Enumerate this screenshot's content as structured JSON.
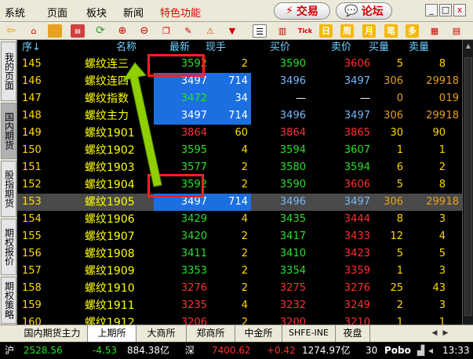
{
  "menu": {
    "items": [
      "系统",
      "页面",
      "板块",
      "新闻"
    ],
    "special": "特色功能",
    "trade": "交易",
    "forum": "论坛"
  },
  "window_buttons": {
    "minimize": "_",
    "restore": "□",
    "close": "x"
  },
  "toolbar": {
    "tick_label": "Tick",
    "chars": [
      "日",
      "周",
      "月",
      "笔",
      "多"
    ]
  },
  "left_tabs": [
    "我的页面",
    "国内期货",
    "股指期货",
    "期权报价",
    "期权策略"
  ],
  "headers": {
    "seq": "序↓",
    "name": "名称",
    "latest": "最新",
    "vol": "现手",
    "bid": "买价",
    "ask": "卖价",
    "bidv": "买量",
    "askv": "卖量"
  },
  "rows": [
    {
      "seq": "145",
      "name": "螺纹连三",
      "latest": "3592",
      "vol": "2",
      "bid": "3590",
      "ask": "3606",
      "bidv": "5",
      "askv": "8",
      "extra": "",
      "lc": "grn",
      "bc": "grn",
      "ac": "red"
    },
    {
      "seq": "146",
      "name": "螺纹连四",
      "latest": "3497",
      "vol": "714",
      "bid": "3496",
      "ask": "3497",
      "bidv": "306",
      "askv": "299",
      "extra": "18",
      "lc": "wht",
      "bc": "lb",
      "ac": "lb",
      "hl": true
    },
    {
      "seq": "147",
      "name": "螺纹指数",
      "latest": "3472",
      "vol": "34",
      "bid": "—",
      "ask": "—",
      "bidv": "0",
      "askv": "0",
      "extra": "19",
      "lc": "grn",
      "bc": "wht",
      "ac": "wht",
      "hl": true
    },
    {
      "seq": "148",
      "name": "螺纹主力",
      "latest": "3497",
      "vol": "714",
      "bid": "3496",
      "ask": "3497",
      "bidv": "306",
      "askv": "299",
      "extra": "18",
      "lc": "wht",
      "bc": "lb",
      "ac": "lb",
      "hl": true
    },
    {
      "seq": "149",
      "name": "螺纹1901",
      "latest": "3864",
      "vol": "60",
      "bid": "3864",
      "ask": "3865",
      "bidv": "30",
      "askv": "90",
      "extra": "",
      "lc": "red",
      "bc": "red",
      "ac": "red"
    },
    {
      "seq": "150",
      "name": "螺纹1902",
      "latest": "3595",
      "vol": "4",
      "bid": "3594",
      "ask": "3607",
      "bidv": "1",
      "askv": "1",
      "extra": "",
      "lc": "grn",
      "bc": "grn",
      "ac": "grn"
    },
    {
      "seq": "151",
      "name": "螺纹1903",
      "latest": "3577",
      "vol": "2",
      "bid": "3580",
      "ask": "3594",
      "bidv": "6",
      "askv": "2",
      "extra": "",
      "lc": "grn",
      "bc": "grn",
      "ac": "grn"
    },
    {
      "seq": "152",
      "name": "螺纹1904",
      "latest": "3592",
      "vol": "2",
      "bid": "3590",
      "ask": "3606",
      "bidv": "5",
      "askv": "8",
      "extra": "",
      "lc": "grn",
      "bc": "grn",
      "ac": "red"
    },
    {
      "seq": "153",
      "name": "螺纹1905",
      "latest": "3497",
      "vol": "714",
      "bid": "3496",
      "ask": "3497",
      "bidv": "306",
      "askv": "299",
      "extra": "18",
      "lc": "wht",
      "bc": "lb",
      "ac": "lb",
      "hl": true,
      "sel": true
    },
    {
      "seq": "154",
      "name": "螺纹1906",
      "latest": "3429",
      "vol": "4",
      "bid": "3435",
      "ask": "3444",
      "bidv": "8",
      "askv": "3",
      "extra": "",
      "lc": "grn",
      "bc": "grn",
      "ac": "red"
    },
    {
      "seq": "155",
      "name": "螺纹1907",
      "latest": "3420",
      "vol": "2",
      "bid": "3417",
      "ask": "3433",
      "bidv": "12",
      "askv": "4",
      "extra": "",
      "lc": "grn",
      "bc": "grn",
      "ac": "red"
    },
    {
      "seq": "156",
      "name": "螺纹1908",
      "latest": "3411",
      "vol": "2",
      "bid": "3410",
      "ask": "3423",
      "bidv": "5",
      "askv": "5",
      "extra": "",
      "lc": "grn",
      "bc": "grn",
      "ac": "red"
    },
    {
      "seq": "157",
      "name": "螺纹1909",
      "latest": "3353",
      "vol": "2",
      "bid": "3354",
      "ask": "3359",
      "bidv": "1",
      "askv": "3",
      "extra": "",
      "lc": "grn",
      "bc": "grn",
      "ac": "red"
    },
    {
      "seq": "158",
      "name": "螺纹1910",
      "latest": "3276",
      "vol": "2",
      "bid": "3275",
      "ask": "3276",
      "bidv": "25",
      "askv": "43",
      "extra": "",
      "lc": "red",
      "bc": "red",
      "ac": "red"
    },
    {
      "seq": "159",
      "name": "螺纹1911",
      "latest": "3235",
      "vol": "4",
      "bid": "3232",
      "ask": "3249",
      "bidv": "2",
      "askv": "3",
      "extra": "",
      "lc": "red",
      "bc": "red",
      "ac": "red"
    },
    {
      "seq": "160",
      "name": "螺纹1912",
      "latest": "3206",
      "vol": "2",
      "bid": "3200",
      "ask": "3210",
      "bidv": "1",
      "askv": "1",
      "extra": "",
      "lc": "red",
      "bc": "red",
      "ac": "red"
    }
  ],
  "bottom_tabs": [
    "国内期货主力",
    "上期所",
    "大商所",
    "郑商所",
    "中金所",
    "SHFE-INE",
    "夜盘"
  ],
  "status": {
    "sh_label": "沪",
    "sh_index": "2528.56",
    "sh_change": "-4.53",
    "sh_amount": "884.38亿",
    "sz_label": "深",
    "sz_index": "7400.62",
    "sz_change": "+0.42",
    "sz_amount": "1274.97亿",
    "num": "30",
    "brand": "Pobo",
    "time": "13:33"
  },
  "colors": {
    "up": "#ff3030",
    "down": "#28e028",
    "header": "#6fd1ff",
    "name": "#ffff00",
    "highlight": "#1c6fe0",
    "annotation": "#ff2020",
    "arrow": "#8fcf00"
  }
}
